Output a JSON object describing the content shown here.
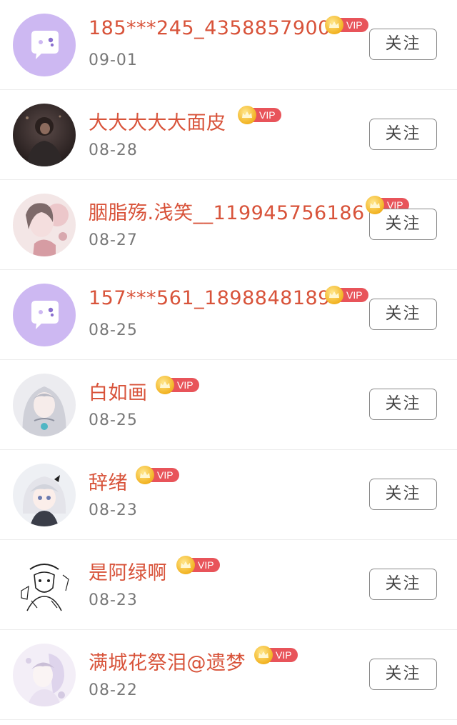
{
  "follow_label": "关注",
  "vip_label": "VIP",
  "users": [
    {
      "name": "185***245_4358857900",
      "date": "09-01"
    },
    {
      "name": "大大大大大面皮",
      "date": "08-28"
    },
    {
      "name": "胭脂殇.浅笑__119945756186",
      "date": "08-27"
    },
    {
      "name": "157***561_1898848189",
      "date": "08-25"
    },
    {
      "name": "白如画",
      "date": "08-25"
    },
    {
      "name": "辞绪",
      "date": "08-23"
    },
    {
      "name": "是阿绿啊",
      "date": "08-23"
    },
    {
      "name": "满城花祭泪@遗梦",
      "date": "08-22"
    }
  ],
  "colors": {
    "name": "#d8533a",
    "date": "#777777",
    "vip_badge": "#e8545a",
    "default_avatar": "#cdb8f2"
  }
}
